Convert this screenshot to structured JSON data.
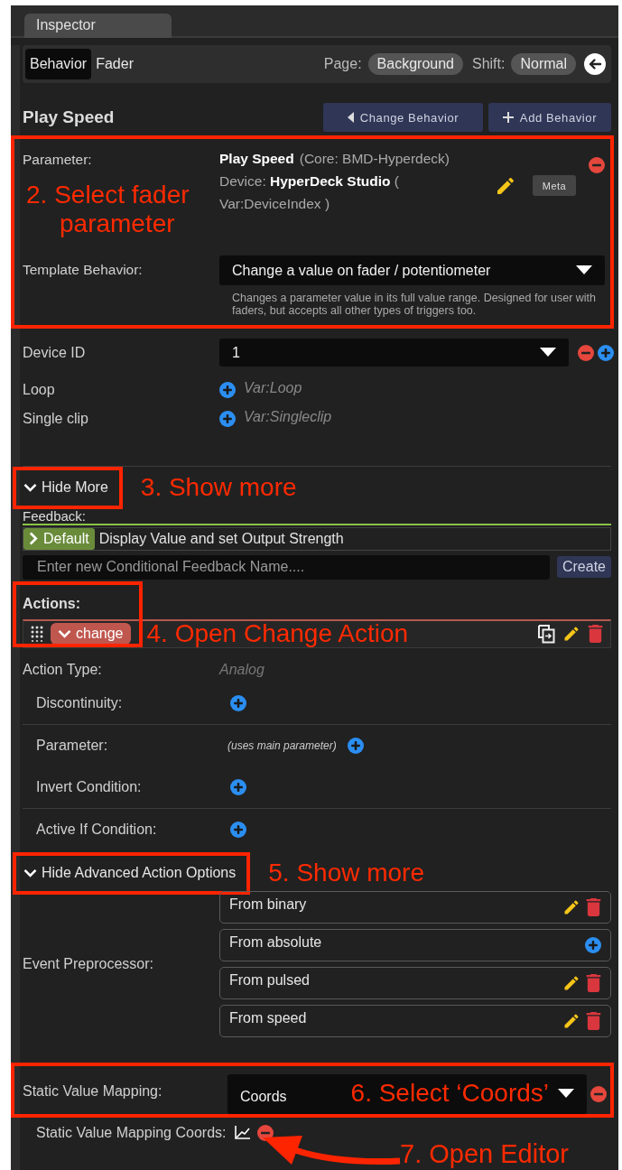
{
  "panel_tab": "Inspector",
  "tabs": [
    {
      "label": "Behavior",
      "selected": true
    },
    {
      "label": "Fader",
      "selected": false
    }
  ],
  "page": {
    "label": "Page:",
    "value": "Background"
  },
  "shift": {
    "label": "Shift:",
    "value": "Normal"
  },
  "title": "Play Speed",
  "header_buttons": [
    {
      "label": "Change Behavior",
      "kind": "back"
    },
    {
      "label": "Add Behavior",
      "kind": "add"
    }
  ],
  "parameter": {
    "label": "Parameter:",
    "name": "Play Speed",
    "source": "(Core: BMD-Hyperdeck)",
    "device": "Device: **HyperDeck Studio** ( Var:DeviceIndex )",
    "meta_button": "Meta",
    "annotation": "2. Select fader parameter"
  },
  "template": {
    "label": "Template Behavior:",
    "value": "Change a value on fader / potentiometer",
    "description": "Changes a parameter value in its full value range. Designed for user with faders, but accepts all other types of triggers too."
  },
  "settings": [
    {
      "label": "Device ID",
      "kind": "dropdown",
      "value": "1"
    },
    {
      "label": "Loop",
      "kind": "variable",
      "value": "Var:Loop"
    },
    {
      "label": "Single clip",
      "kind": "variable",
      "value": "Var:Singleclip"
    }
  ],
  "more_toggle": {
    "label": "Hide More",
    "expanded": true,
    "annotation": "3. Show more"
  },
  "feedback": {
    "label": "Feedback:",
    "items": [
      {
        "badge": "Default",
        "text": "Display Value and set Output Strength",
        "expanded": false
      }
    ],
    "placeholder": "Enter new Conditional Feedback Name....",
    "create_button": "Create"
  },
  "actions": {
    "label": "Actions:",
    "items": [
      {
        "label": "change",
        "expanded": true
      }
    ],
    "annotation": "4. Open Change Action"
  },
  "action_type": {
    "label": "Action Type:",
    "value": "Analog"
  },
  "action_options": [
    {
      "options": [
        {
          "label": "Discontinuity:"
        }
      ]
    },
    {
      "options": [
        {
          "label": "Parameter:",
          "hint": "(uses main parameter)"
        },
        {
          "label": "Invert Condition:"
        }
      ]
    },
    {
      "options": [
        {
          "label": "Active If Condition:"
        }
      ]
    }
  ],
  "advanced_toggle": {
    "label": "Hide Advanced Action Options",
    "expanded": true,
    "annotation": "5. Show more"
  },
  "preprocessor": {
    "label": "Event Preprocessor:",
    "items": [
      {
        "label": "From binary",
        "kind": "set"
      },
      {
        "label": "From absolute",
        "kind": "unset"
      },
      {
        "label": "From pulsed",
        "kind": "set"
      },
      {
        "label": "From speed",
        "kind": "set"
      }
    ]
  },
  "mapping": {
    "label": "Static Value Mapping:",
    "value": "Coords",
    "annotation": "6. Select ‘Coords’"
  },
  "coords": {
    "label": "Static Value Mapping Coords:",
    "annotation": "7. Open Editor"
  }
}
